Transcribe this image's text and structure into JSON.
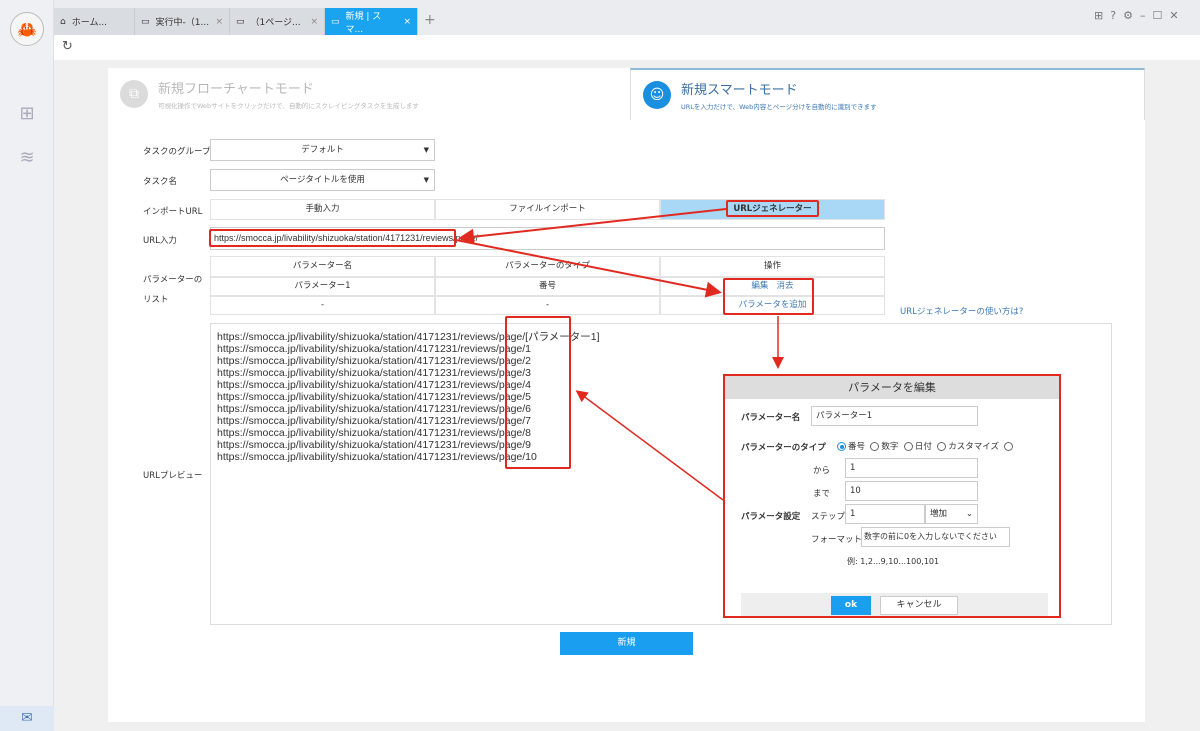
{
  "tabs": [
    {
      "label": "ホーム...",
      "icon": "home-icon"
    },
    {
      "label": "実行中-（1...",
      "icon": "window-icon"
    },
    {
      "label": "（1ページ...",
      "icon": "window-icon"
    },
    {
      "label": "新規 | スマ...",
      "icon": "window-icon",
      "active": true
    }
  ],
  "modes": {
    "flowchart": {
      "title": "新規フローチャートモード",
      "subtitle": "可視化操作でWebサイトをクリックだけで、自動的にスクレイピングタスクを生成します"
    },
    "smart": {
      "title": "新規スマートモード",
      "subtitle": "URLを入力だけで、Web内容とページ分けを自動的に識別できます"
    }
  },
  "form": {
    "group_label": "タスクのグループ",
    "group_value": "デフォルト",
    "name_label": "タスク名",
    "name_value": "ページタイトルを使用",
    "import_label": "インポートURL",
    "import_tabs": [
      "手動入力",
      "ファイルインポート",
      "URLジェネレーター"
    ],
    "url_label": "URL入力",
    "url_value": "https://smocca.jp/livability/shizuoka/station/4171231/reviews/page/",
    "param_label": "パラメーターのリスト",
    "param_headers": [
      "パラメーター名",
      "パラメーターのタイプ",
      "操作"
    ],
    "param_row": {
      "name": "パラメーター1",
      "type": "番号",
      "edit": "編集",
      "delete": "消去"
    },
    "empty_row": {
      "name": "-",
      "type": "-",
      "add": "パラメータを追加"
    },
    "help_link": "URLジェネレーターの使い方は?",
    "preview_label": "URLプレビュー",
    "preview_lines": [
      "https://smocca.jp/livability/shizuoka/station/4171231/reviews/page/[パラメーター1]",
      "https://smocca.jp/livability/shizuoka/station/4171231/reviews/page/1",
      "https://smocca.jp/livability/shizuoka/station/4171231/reviews/page/2",
      "https://smocca.jp/livability/shizuoka/station/4171231/reviews/page/3",
      "https://smocca.jp/livability/shizuoka/station/4171231/reviews/page/4",
      "https://smocca.jp/livability/shizuoka/station/4171231/reviews/page/5",
      "https://smocca.jp/livability/shizuoka/station/4171231/reviews/page/6",
      "https://smocca.jp/livability/shizuoka/station/4171231/reviews/page/7",
      "https://smocca.jp/livability/shizuoka/station/4171231/reviews/page/8",
      "https://smocca.jp/livability/shizuoka/station/4171231/reviews/page/9",
      "https://smocca.jp/livability/shizuoka/station/4171231/reviews/page/10"
    ],
    "submit": "新規"
  },
  "dialog": {
    "title": "パラメータを編集",
    "name_label": "パラメーター名",
    "name_value": "パラメーター1",
    "type_label": "パラメーターのタイプ",
    "types": [
      "番号",
      "数字",
      "日付",
      "カスタマイズ",
      ""
    ],
    "from_label": "から",
    "from_value": "1",
    "to_label": "まで",
    "to_value": "10",
    "settings_label": "パラメータ設定",
    "step_label": "ステップ",
    "step_value": "1",
    "step_dir": "増加",
    "format_label": "フォーマット",
    "format_value": "数字の前に0を入力しないでください",
    "example": "例: 1,2...9,10...100,101",
    "ok": "ok",
    "cancel": "キャンセル"
  },
  "colors": {
    "accent": "#1aa3ef",
    "annotation": "#e02a20",
    "active_tab": "#a8d8f5"
  }
}
